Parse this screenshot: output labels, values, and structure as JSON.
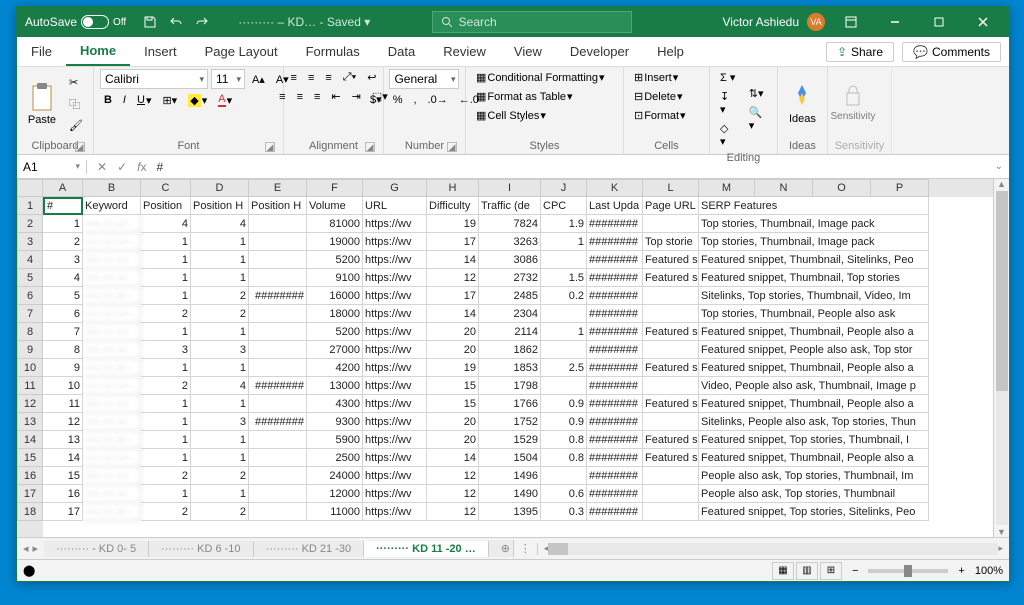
{
  "titlebar": {
    "autosave": "AutoSave",
    "autosave_state": "Off",
    "doc_name": "········· – KD… - Saved ▾",
    "search_placeholder": "Search",
    "user_name": "Victor Ashiedu",
    "user_initials": "VA"
  },
  "tabs": {
    "file": "File",
    "home": "Home",
    "insert": "Insert",
    "page_layout": "Page Layout",
    "formulas": "Formulas",
    "data": "Data",
    "review": "Review",
    "view": "View",
    "developer": "Developer",
    "help": "Help",
    "share": "Share",
    "comments": "Comments"
  },
  "ribbon": {
    "clipboard": {
      "label": "Clipboard",
      "paste": "Paste"
    },
    "font": {
      "label": "Font",
      "name": "Calibri",
      "size": "11"
    },
    "alignment": {
      "label": "Alignment"
    },
    "number": {
      "label": "Number",
      "format": "General"
    },
    "styles": {
      "label": "Styles",
      "cond_fmt": "Conditional Formatting",
      "as_table": "Format as Table",
      "cell_styles": "Cell Styles"
    },
    "cells": {
      "label": "Cells",
      "insert": "Insert",
      "delete": "Delete",
      "format": "Format"
    },
    "editing": {
      "label": "Editing"
    },
    "ideas": {
      "label": "Ideas",
      "btn": "Ideas"
    },
    "sensitivity": {
      "label": "Sensitivity",
      "btn": "Sensitivity"
    }
  },
  "namebox": {
    "ref": "A1",
    "formula": "#"
  },
  "columns": [
    {
      "letter": "A",
      "w": 40
    },
    {
      "letter": "B",
      "w": 58
    },
    {
      "letter": "C",
      "w": 50
    },
    {
      "letter": "D",
      "w": 58
    },
    {
      "letter": "E",
      "w": 58
    },
    {
      "letter": "F",
      "w": 56
    },
    {
      "letter": "G",
      "w": 64
    },
    {
      "letter": "H",
      "w": 52
    },
    {
      "letter": "I",
      "w": 62
    },
    {
      "letter": "J",
      "w": 46
    },
    {
      "letter": "K",
      "w": 56
    },
    {
      "letter": "L",
      "w": 56
    },
    {
      "letter": "M",
      "w": 56
    },
    {
      "letter": "N",
      "w": 58
    },
    {
      "letter": "O",
      "w": 58
    },
    {
      "letter": "P",
      "w": 58
    }
  ],
  "headers": [
    "#",
    "Keyword",
    "Position",
    "Position H",
    "Position H",
    "Volume",
    "URL",
    "Difficulty",
    "Traffic (de",
    "CPC",
    "Last Upda",
    "Page URL i",
    "SERP Features",
    "",
    "",
    ""
  ],
  "rows": [
    {
      "n": 1,
      "kw": "···· ··· ···",
      "pos": 4,
      "ph1": 4,
      "ph2": "",
      "vol": 81000,
      "url": "https://wv",
      "diff": 19,
      "traf": 7824,
      "cpc": 1.9,
      "lu": "########",
      "pu": "",
      "serp": "Top stories, Thumbnail, Image pack"
    },
    {
      "n": 2,
      "kw": "···· ··· ···",
      "pos": 1,
      "ph1": 1,
      "ph2": "",
      "vol": 19000,
      "url": "https://wv",
      "diff": 17,
      "traf": 3263,
      "cpc": 1,
      "lu": "########",
      "pu": "Top storie",
      "serp": "Top stories, Thumbnail, Image pack"
    },
    {
      "n": 3,
      "kw": "···· ··· ···",
      "pos": 1,
      "ph1": 1,
      "ph2": "",
      "vol": 5200,
      "url": "https://wv",
      "diff": 14,
      "traf": 3086,
      "cpc": "",
      "lu": "########",
      "pu": "Featured s",
      "serp": "Featured snippet, Thumbnail, Sitelinks, Peo"
    },
    {
      "n": 4,
      "kw": "···· ··· ···",
      "pos": 1,
      "ph1": 1,
      "ph2": "",
      "vol": 9100,
      "url": "https://wv",
      "diff": 12,
      "traf": 2732,
      "cpc": 1.5,
      "lu": "########",
      "pu": "Featured s",
      "serp": "Featured snippet, Thumbnail, Top stories"
    },
    {
      "n": 5,
      "kw": "···· ··· ···",
      "pos": 1,
      "ph1": 2,
      "ph2": "########",
      "vol": 16000,
      "url": "https://wv",
      "diff": 17,
      "traf": 2485,
      "cpc": 0.2,
      "lu": "########",
      "pu": "",
      "serp": "Sitelinks, Top stories, Thumbnail, Video, Im"
    },
    {
      "n": 6,
      "kw": "···· ··· ···",
      "pos": 2,
      "ph1": 2,
      "ph2": "",
      "vol": 18000,
      "url": "https://wv",
      "diff": 14,
      "traf": 2304,
      "cpc": "",
      "lu": "########",
      "pu": "",
      "serp": "Top stories, Thumbnail, People also ask"
    },
    {
      "n": 7,
      "kw": "···· ··· ···",
      "pos": 1,
      "ph1": 1,
      "ph2": "",
      "vol": 5200,
      "url": "https://wv",
      "diff": 20,
      "traf": 2114,
      "cpc": 1,
      "lu": "########",
      "pu": "Featured s",
      "serp": "Featured snippet, Thumbnail, People also a"
    },
    {
      "n": 8,
      "kw": "···· ··· ···",
      "pos": 3,
      "ph1": 3,
      "ph2": "",
      "vol": 27000,
      "url": "https://wv",
      "diff": 20,
      "traf": 1862,
      "cpc": "",
      "lu": "########",
      "pu": "",
      "serp": "Featured snippet, People also ask, Top stor"
    },
    {
      "n": 9,
      "kw": "···· ··· ···",
      "pos": 1,
      "ph1": 1,
      "ph2": "",
      "vol": 4200,
      "url": "https://wv",
      "diff": 19,
      "traf": 1853,
      "cpc": 2.5,
      "lu": "########",
      "pu": "Featured s",
      "serp": "Featured snippet, Thumbnail, People also a"
    },
    {
      "n": 10,
      "kw": "···· ··· ···",
      "pos": 2,
      "ph1": 4,
      "ph2": "########",
      "vol": 13000,
      "url": "https://wv",
      "diff": 15,
      "traf": 1798,
      "cpc": "",
      "lu": "########",
      "pu": "",
      "serp": "Video, People also ask, Thumbnail, Image p"
    },
    {
      "n": 11,
      "kw": "···· ··· ···",
      "pos": 1,
      "ph1": 1,
      "ph2": "",
      "vol": 4300,
      "url": "https://wv",
      "diff": 15,
      "traf": 1766,
      "cpc": 0.9,
      "lu": "########",
      "pu": "Featured s",
      "serp": "Featured snippet, Thumbnail, People also a"
    },
    {
      "n": 12,
      "kw": "···· ··· ···",
      "pos": 1,
      "ph1": 3,
      "ph2": "########",
      "vol": 9300,
      "url": "https://wv",
      "diff": 20,
      "traf": 1752,
      "cpc": 0.9,
      "lu": "########",
      "pu": "",
      "serp": "Sitelinks, People also ask, Top stories, Thun"
    },
    {
      "n": 13,
      "kw": "···· ··· ···",
      "pos": 1,
      "ph1": 1,
      "ph2": "",
      "vol": 5900,
      "url": "https://wv",
      "diff": 20,
      "traf": 1529,
      "cpc": 0.8,
      "lu": "########",
      "pu": "Featured s",
      "serp": "Featured snippet, Top stories, Thumbnail, I"
    },
    {
      "n": 14,
      "kw": "···· ··· ···",
      "pos": 1,
      "ph1": 1,
      "ph2": "",
      "vol": 2500,
      "url": "https://wv",
      "diff": 14,
      "traf": 1504,
      "cpc": 0.8,
      "lu": "########",
      "pu": "Featured s",
      "serp": "Featured snippet, Thumbnail, People also a"
    },
    {
      "n": 15,
      "kw": "···· ··· ···",
      "pos": 2,
      "ph1": 2,
      "ph2": "",
      "vol": 24000,
      "url": "https://wv",
      "diff": 12,
      "traf": 1496,
      "cpc": "",
      "lu": "########",
      "pu": "",
      "serp": "People also ask, Top stories, Thumbnail, Im"
    },
    {
      "n": 16,
      "kw": "···· ··· ···",
      "pos": 1,
      "ph1": 1,
      "ph2": "",
      "vol": 12000,
      "url": "https://wv",
      "diff": 12,
      "traf": 1490,
      "cpc": 0.6,
      "lu": "########",
      "pu": "",
      "serp": "People also ask, Top stories, Thumbnail"
    },
    {
      "n": 17,
      "kw": "···· ··· ···",
      "pos": 2,
      "ph1": 2,
      "ph2": "",
      "vol": 11000,
      "url": "https://wv",
      "diff": 12,
      "traf": 1395,
      "cpc": 0.3,
      "lu": "########",
      "pu": "",
      "serp": "Featured snippet, Top stories, Sitelinks, Peo"
    }
  ],
  "sheets": {
    "s1": "········· - KD 0- 5",
    "s2": "········· KD 6 -10",
    "s3": "········· KD 21 -30",
    "s4": "········· KD 11 -20 …",
    "add": "⊕",
    "more": "⋮"
  },
  "status": {
    "zoom": "100%",
    "minus": "−",
    "plus": "+"
  }
}
